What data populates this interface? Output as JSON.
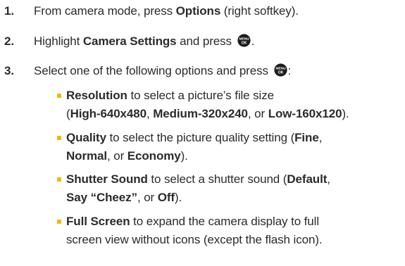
{
  "steps": [
    {
      "number": "1.",
      "text_before": "From camera mode, press ",
      "bold": "Options",
      "text_after": " (right softkey)."
    },
    {
      "number": "2.",
      "text_before": "Highlight ",
      "bold": "Camera Settings",
      "text_after": " and press ",
      "end": "."
    },
    {
      "number": "3.",
      "text_before": "Select one of the following options and press ",
      "end": ":"
    }
  ],
  "key_icon": {
    "name": "menu-ok-key-icon",
    "top_label": "MENU",
    "bottom_label": "OK",
    "color": "#1c1c1c"
  },
  "options": [
    {
      "label": "Resolution",
      "line1": " to select a picture’s file size",
      "line2_parts": [
        {
          "t": "(",
          "b": false
        },
        {
          "t": "High-640x480",
          "b": true
        },
        {
          "t": ", ",
          "b": false
        },
        {
          "t": "Medium-320x240",
          "b": true
        },
        {
          "t": ", or ",
          "b": false
        },
        {
          "t": "Low-160x120",
          "b": true
        },
        {
          "t": ").",
          "b": false
        }
      ]
    },
    {
      "label": "Quality",
      "line1_parts": [
        {
          "t": " to select the picture quality setting (",
          "b": false
        },
        {
          "t": "Fine",
          "b": true
        },
        {
          "t": ",",
          "b": false
        }
      ],
      "line2_parts": [
        {
          "t": "Normal",
          "b": true
        },
        {
          "t": ", or ",
          "b": false
        },
        {
          "t": "Economy",
          "b": true
        },
        {
          "t": ").",
          "b": false
        }
      ]
    },
    {
      "label": "Shutter Sound",
      "line1_parts": [
        {
          "t": " to select a shutter sound (",
          "b": false
        },
        {
          "t": "Default",
          "b": true
        },
        {
          "t": ",",
          "b": false
        }
      ],
      "line2_parts": [
        {
          "t": "Say “Cheez”",
          "b": true
        },
        {
          "t": ", or ",
          "b": false
        },
        {
          "t": "Off",
          "b": true
        },
        {
          "t": ").",
          "b": false
        }
      ]
    },
    {
      "label": "Full Screen",
      "line1": " to expand the camera display to full",
      "line2": "screen view without icons (except the flash icon)."
    }
  ],
  "colors": {
    "text": "#2b2b2b",
    "bullet": "#f5b800"
  }
}
